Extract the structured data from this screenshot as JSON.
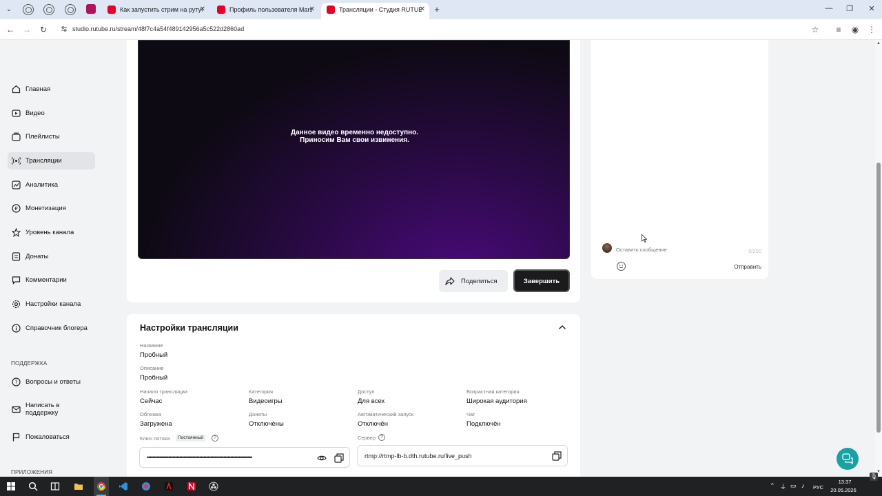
{
  "browser": {
    "tabs": [
      {
        "title": "Как запустить стрим на рутубе",
        "active": false
      },
      {
        "title": "Профиль пользователя Marsh",
        "active": false
      },
      {
        "title": "Трансляции - Студия RUTUBE",
        "active": true
      }
    ],
    "new_tab_symbol": "+",
    "url": "studio.rutube.ru/stream/48f7c4a54f489142956a5c522d2860ad"
  },
  "sidebar": {
    "items": [
      {
        "label": "Главная",
        "icon": "home-icon"
      },
      {
        "label": "Видео",
        "icon": "video-icon"
      },
      {
        "label": "Плейлисты",
        "icon": "playlist-icon"
      },
      {
        "label": "Трансляции",
        "icon": "broadcast-icon",
        "active": true
      },
      {
        "label": "Аналитика",
        "icon": "analytics-icon"
      },
      {
        "label": "Монетизация",
        "icon": "money-icon"
      },
      {
        "label": "Уровень канала",
        "icon": "star-icon"
      },
      {
        "label": "Донаты",
        "icon": "donate-icon"
      },
      {
        "label": "Комментарии",
        "icon": "comment-icon"
      },
      {
        "label": "Настройки канала",
        "icon": "gear-icon"
      },
      {
        "label": "Справочник блогера",
        "icon": "info-icon"
      }
    ],
    "support_section": "ПОДДЕРЖКА",
    "support_items": [
      {
        "label": "Вопросы и ответы",
        "icon": "question-icon"
      },
      {
        "label": "Написать в поддержку",
        "icon": "mail-icon"
      },
      {
        "label": "Пожаловаться",
        "icon": "flag-icon"
      }
    ],
    "apps_section": "ПРИЛОЖЕНИЯ"
  },
  "player": {
    "message_line1": "Данное видео временно недоступно.",
    "message_line2": "Приносим Вам свои извинения."
  },
  "actions": {
    "share_label": "Поделиться",
    "finish_label": "Завершить"
  },
  "settings": {
    "title": "Настройки трансляции",
    "name_label": "Название",
    "name_value": "Пробный",
    "description_label": "Описание",
    "description_value": "Пробный",
    "start_label": "Начало трансляции",
    "start_value": "Сейчас",
    "category_label": "Категория",
    "category_value": "Видеоигры",
    "access_label": "Доступ",
    "access_value": "Для всех",
    "age_label": "Возрастная категория",
    "age_value": "Широкая аудитория",
    "cover_label": "Обложка",
    "cover_value": "Загружена",
    "donates_label": "Донаты",
    "donates_value": "Отключены",
    "autostart_label": "Автоматический запуск",
    "autostart_value": "Отключён",
    "chat_label": "Чат",
    "chat_value": "Подключён",
    "stream_key_label": "Ключ потока",
    "stream_key_badge": "Постоянный",
    "stream_key_value": "••••••••••••••••••••••••••••••••••••••••••••••••••••••••••••••••••••••••••••••",
    "server_label": "Сервер",
    "server_value": "rtmp://rtmp-lb-b.dth.rutube.ru/live_push"
  },
  "chat": {
    "placeholder": "Оставить сообщение",
    "counter": "0/200",
    "send_label": "Отправить"
  },
  "taskbar": {
    "lang": "РУС",
    "time": "13:37",
    "date": "20.05.2026"
  }
}
